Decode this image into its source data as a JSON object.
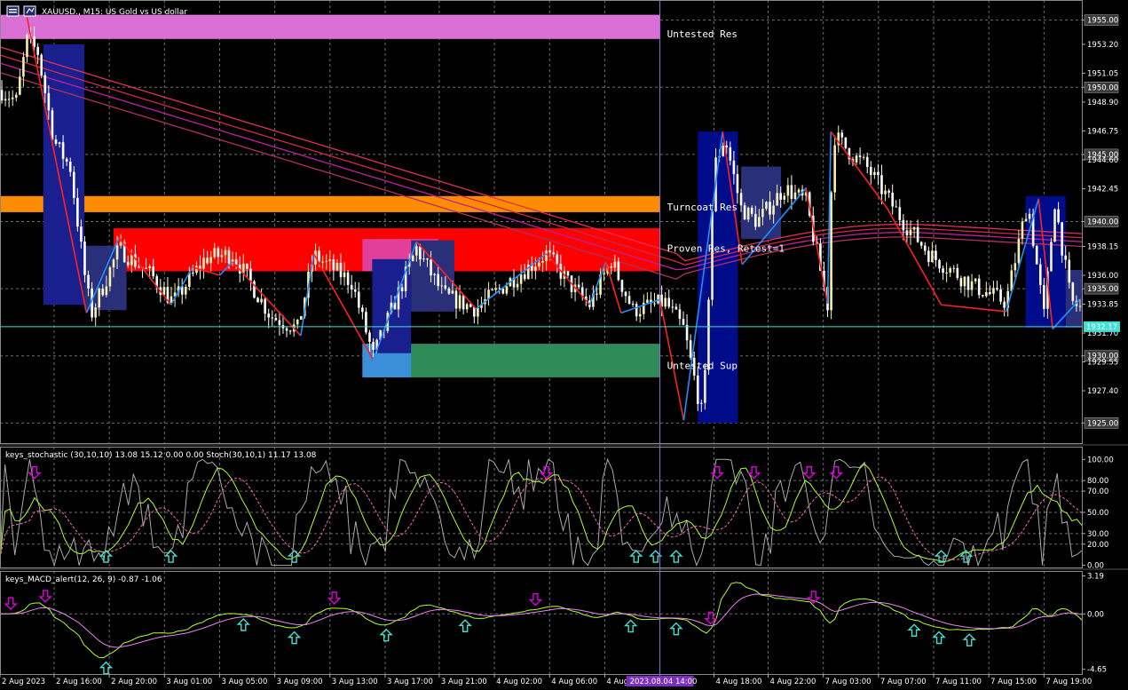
{
  "window": {
    "symbol": "XAUUSD.",
    "timeframe": "M15",
    "description": "US Gold vs US dollar",
    "title": "XAUUSD., M15:  US Gold vs US dollar"
  },
  "colors": {
    "background": "#000000",
    "bull": "#F5F0B0",
    "bear": "#FFFFFF",
    "grid": "#6E6E6E",
    "untested_res": "#DA70D6",
    "turncoat_res": "#FF8C00",
    "proven_res": "#FF0000",
    "untested_sup": "#2E8B57",
    "zigzag_up": "#1E90FF",
    "zigzag_down": "#FF2020",
    "bid_line": "#40E0D0",
    "period_sep": "#9370DB",
    "stoch_main": "#A9A9A9",
    "stoch_signal": "#FF69B4",
    "stoch_smooth": "#ADFF2F",
    "macd_main": "#ADFF2F",
    "macd_signal": "#EE82EE",
    "arrow_up": "#40E0D0",
    "arrow_down": "#DA00DA"
  },
  "chart_data": [
    {
      "type": "candlestick",
      "name": "main",
      "ylim": [
        1923.5,
        1956.5
      ],
      "price_ticks": [
        {
          "value": 1955.0,
          "label": "1955.00",
          "boxed": true
        },
        {
          "value": 1953.2,
          "label": "1953.20",
          "boxed": false
        },
        {
          "value": 1951.05,
          "label": "1951.05",
          "boxed": false
        },
        {
          "value": 1950.0,
          "label": "1950.00",
          "boxed": true
        },
        {
          "value": 1948.9,
          "label": "1948.90",
          "boxed": false
        },
        {
          "value": 1946.75,
          "label": "1946.75",
          "boxed": false
        },
        {
          "value": 1945.0,
          "label": "1945.00",
          "boxed": true
        },
        {
          "value": 1944.6,
          "label": "1944.60",
          "boxed": false
        },
        {
          "value": 1942.45,
          "label": "1942.45",
          "boxed": false
        },
        {
          "value": 1940.0,
          "label": "1940.00",
          "boxed": true
        },
        {
          "value": 1938.15,
          "label": "1938.15",
          "boxed": false
        },
        {
          "value": 1936.0,
          "label": "1936.00",
          "boxed": false
        },
        {
          "value": 1935.0,
          "label": "1935.00",
          "boxed": true
        },
        {
          "value": 1933.85,
          "label": "1933.85",
          "boxed": false
        },
        {
          "value": 1931.7,
          "label": "1931.70",
          "boxed": false
        },
        {
          "value": 1930.0,
          "label": "1930.00",
          "boxed": true
        },
        {
          "value": 1929.55,
          "label": "1929.55",
          "boxed": false
        },
        {
          "value": 1927.4,
          "label": "1927.40",
          "boxed": false
        },
        {
          "value": 1925.0,
          "label": "1925.00",
          "boxed": true
        }
      ],
      "current_price": {
        "value": 1932.17,
        "label": "1932.17"
      },
      "zones": [
        {
          "label": "Untested Res",
          "top": 1955.4,
          "bottom": 1953.6,
          "color": "#DA70D6",
          "x_start": 0.0,
          "x_end": 0.61
        },
        {
          "label": "Turncoat Res",
          "top": 1941.9,
          "bottom": 1940.7,
          "color": "#FF8C00",
          "x_start": 0.0,
          "x_end": 0.61
        },
        {
          "label": "Proven Res, Retest=1",
          "top": 1939.5,
          "bottom": 1936.3,
          "color": "#FF0000",
          "x_start": 0.105,
          "x_end": 0.61
        },
        {
          "label": "Untested Sup",
          "top": 1930.9,
          "bottom": 1928.4,
          "color": "#2E8B57",
          "x_start": 0.335,
          "x_end": 0.61
        }
      ],
      "seed": 7
    },
    {
      "type": "line",
      "name": "stochastic",
      "title": "keys_stochastic (30,10,10) 13.08 15.12 0.00 0.00 Stoch(30,10,1) 11.17 13.08",
      "ylim": [
        0,
        100
      ],
      "levels": [
        {
          "value": 100.0,
          "label": "100.00"
        },
        {
          "value": 80.0,
          "label": "80.00"
        },
        {
          "value": 70.0,
          "label": "70.00"
        },
        {
          "value": 50.0,
          "label": "50.00"
        },
        {
          "value": 30.0,
          "label": "30.00"
        },
        {
          "value": 20.0,
          "label": "20.00"
        },
        {
          "value": 0.0,
          "label": "0.00"
        }
      ],
      "up_arrows_at": [
        0.098,
        0.158,
        0.272,
        0.588,
        0.606,
        0.625,
        0.87,
        0.893
      ],
      "down_arrows_at": [
        0.032,
        0.505,
        0.663,
        0.697,
        0.748,
        0.773
      ]
    },
    {
      "type": "line",
      "name": "macd",
      "title": "keys_MACD_alert(12, 26, 9) -0.87 -1.06",
      "ylim": [
        -4.65,
        3.19
      ],
      "levels": [
        {
          "value": 3.19,
          "label": "3.19"
        },
        {
          "value": 0.0,
          "label": "0.00"
        },
        {
          "value": -4.65,
          "label": "-4.65"
        }
      ],
      "up_arrows_at": [
        0.098,
        0.225,
        0.272,
        0.357,
        0.43,
        0.583,
        0.625,
        0.845,
        0.868,
        0.896
      ],
      "down_arrows_at": [
        0.01,
        0.042,
        0.309,
        0.495,
        0.657,
        0.752
      ]
    }
  ],
  "time_axis": [
    {
      "label": "2 Aug 2023",
      "pos": 0.0
    },
    {
      "label": "2 Aug 16:00",
      "pos": 0.05
    },
    {
      "label": "2 Aug 20:00",
      "pos": 0.101
    },
    {
      "label": "3 Aug 01:00",
      "pos": 0.152
    },
    {
      "label": "3 Aug 05:00",
      "pos": 0.203
    },
    {
      "label": "3 Aug 09:00",
      "pos": 0.254
    },
    {
      "label": "3 Aug 13:00",
      "pos": 0.305
    },
    {
      "label": "3 Aug 17:00",
      "pos": 0.356
    },
    {
      "label": "3 Aug 21:00",
      "pos": 0.406
    },
    {
      "label": "4 Aug 02:00",
      "pos": 0.457
    },
    {
      "label": "4 Aug 06:00",
      "pos": 0.508
    },
    {
      "label": "4 Aug",
      "pos": 0.559
    },
    {
      "label": "4 Aug 18:00",
      "pos": 0.66
    },
    {
      "label": "4 Aug 22:00",
      "pos": 0.71
    },
    {
      "label": "7 Aug 03:00",
      "pos": 0.761
    },
    {
      "label": "7 Aug 07:00",
      "pos": 0.812
    },
    {
      "label": "7 Aug 11:00",
      "pos": 0.863
    },
    {
      "label": "7 Aug 15:00",
      "pos": 0.914
    },
    {
      "label": "7 Aug 19:00",
      "pos": 0.965
    }
  ],
  "crosshair": {
    "label": "2023.08.04 14:00",
    "pos": 0.61
  }
}
